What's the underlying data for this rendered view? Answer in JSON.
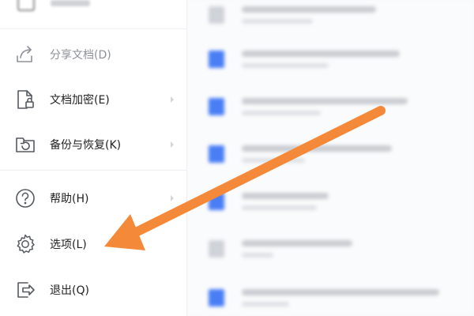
{
  "menu": {
    "items": [
      {
        "key": "share",
        "label": "分享文档(D)",
        "icon": "share-icon",
        "has_submenu": false,
        "disabled": true
      },
      {
        "key": "encrypt",
        "label": "文档加密(E)",
        "icon": "document-lock-icon",
        "has_submenu": true,
        "disabled": false
      },
      {
        "key": "backup",
        "label": "备份与恢复(K)",
        "icon": "folder-restore-icon",
        "has_submenu": true,
        "disabled": false
      },
      {
        "key": "help",
        "label": "帮助(H)",
        "icon": "help-circle-icon",
        "has_submenu": true,
        "disabled": false
      },
      {
        "key": "options",
        "label": "选项(L)",
        "icon": "gear-icon",
        "has_submenu": false,
        "disabled": false
      },
      {
        "key": "exit",
        "label": "退出(Q)",
        "icon": "exit-icon",
        "has_submenu": false,
        "disabled": false
      }
    ]
  },
  "annotation": {
    "arrow_color": "#f5893a",
    "icon": "pointer-arrow",
    "target": "options"
  },
  "colors": {
    "doc_icon": "#4a7ef5",
    "menu_text": "#222222",
    "icon_stroke": "#555a60"
  }
}
